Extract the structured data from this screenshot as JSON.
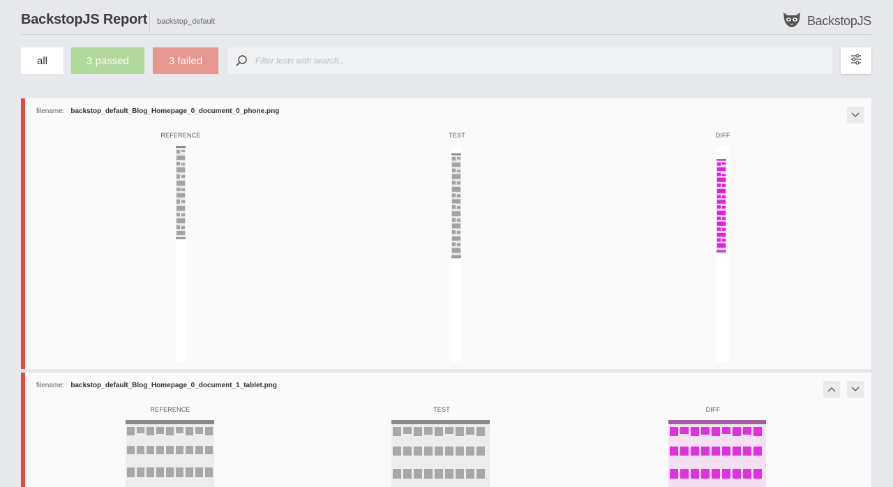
{
  "header": {
    "title": "BackstopJS Report",
    "suite": "backstop_default",
    "brand": "BackstopJS",
    "brand_icon": "mask-icon"
  },
  "filters": {
    "all_label": "all",
    "passed_label": "3 passed",
    "failed_label": "3 failed",
    "passed_color": "#b2d89a",
    "failed_color": "#e89690"
  },
  "search": {
    "placeholder": "Filter tests with search...",
    "value": ""
  },
  "tests": [
    {
      "filename_label": "filename:",
      "filename": "backstop_default_Blog_Homepage_0_document_0_phone.png",
      "columns": [
        "REFERENCE",
        "TEST",
        "DIFF"
      ],
      "status": "failed"
    },
    {
      "filename_label": "filename:",
      "filename": "backstop_default_Blog_Homepage_0_document_1_tablet.png",
      "columns": [
        "REFERENCE",
        "TEST",
        "DIFF"
      ],
      "status": "failed"
    }
  ],
  "colors": {
    "fail_border": "#e8483e",
    "diff_highlight": "#e020e0"
  }
}
